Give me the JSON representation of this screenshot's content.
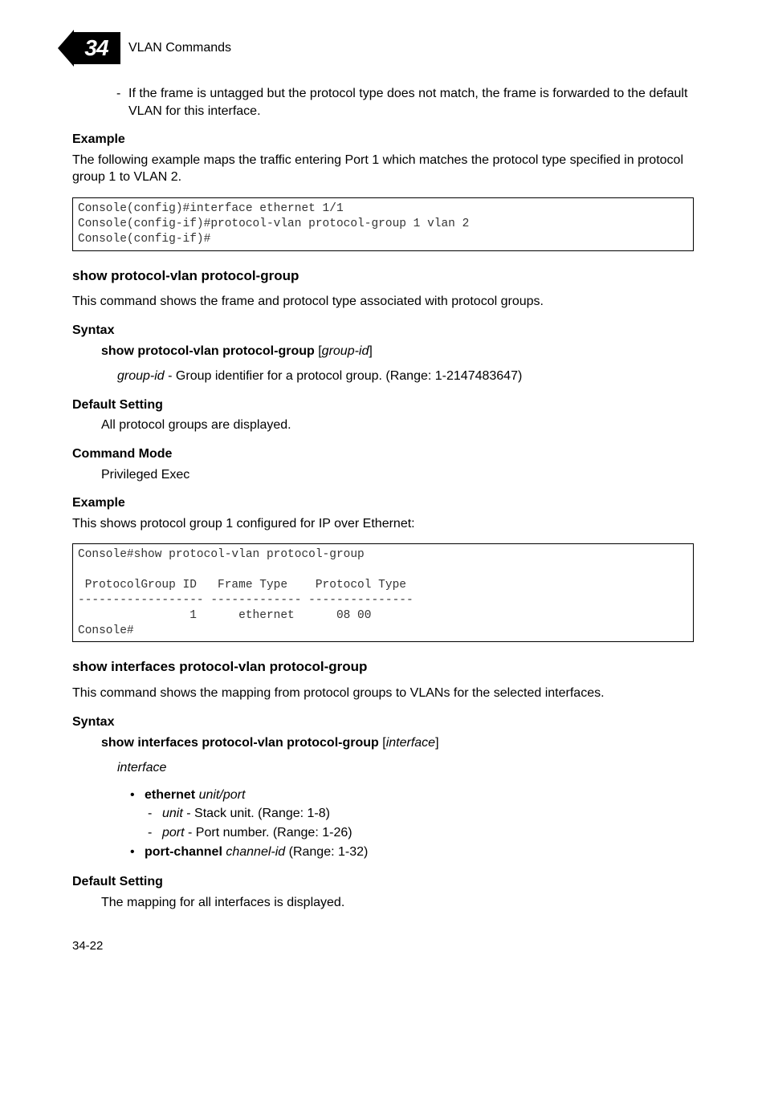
{
  "header": {
    "chapter_num": "34",
    "chapter_title": "VLAN Commands"
  },
  "intro_bullet": {
    "text": "If the frame is untagged but the protocol type does not match, the frame is forwarded to the default VLAN for this interface."
  },
  "example1": {
    "heading": "Example",
    "text": "The following example maps the traffic entering Port 1 which matches the protocol type specified in protocol group 1 to VLAN 2.",
    "code": "Console(config)#interface ethernet 1/1\nConsole(config-if)#protocol-vlan protocol-group 1 vlan 2\nConsole(config-if)#"
  },
  "sec1": {
    "title": "show protocol-vlan protocol-group",
    "desc": "This command shows the frame and protocol type associated with protocol groups.",
    "syntax_heading": "Syntax",
    "syntax_cmd_bold": "show protocol-vlan protocol-group",
    "syntax_arg": "group-id",
    "syntax_arg_label": "group-id",
    "syntax_arg_desc": " - Group identifier for a protocol group. (Range: 1-2147483647)",
    "default_heading": "Default Setting",
    "default_text": "All protocol groups are displayed.",
    "mode_heading": "Command Mode",
    "mode_text": "Privileged Exec",
    "example_heading": "Example",
    "example_text": "This shows protocol group 1 configured for IP over Ethernet:",
    "code": "Console#show protocol-vlan protocol-group\n\n ProtocolGroup ID   Frame Type    Protocol Type\n------------------ ------------- ---------------\n                1      ethernet      08 00\nConsole#"
  },
  "sec2": {
    "title": "show interfaces protocol-vlan protocol-group",
    "desc": "This command shows the mapping from protocol groups to VLANs for the selected interfaces.",
    "syntax_heading": "Syntax",
    "syntax_cmd_bold": "show interfaces protocol-vlan protocol-group",
    "syntax_arg": "interface",
    "interface_label": "interface",
    "eth_label": "ethernet",
    "eth_arg": "unit",
    "eth_sep": "/",
    "eth_arg2": "port",
    "unit_label": "unit",
    "unit_desc": " - Stack unit. (Range: 1-8)",
    "port_label": "port",
    "port_desc": " - Port number. (Range: 1-26)",
    "pc_label": "port-channel",
    "pc_arg": "channel-id",
    "pc_desc": " (Range: 1-32)",
    "default_heading": "Default Setting",
    "default_text": "The mapping for all interfaces is displayed."
  },
  "page_number": "34-22"
}
